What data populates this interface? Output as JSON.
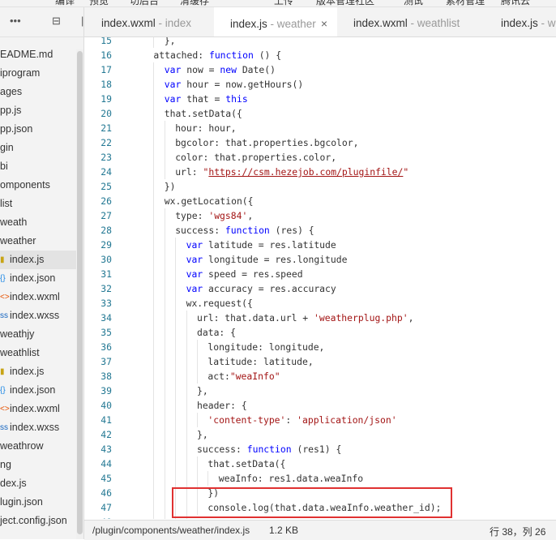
{
  "top_menu": [
    "编译",
    "预览",
    "切后台",
    "清缓存",
    "上传",
    "版本管理",
    "社区",
    "测试",
    "素材管理",
    "腾讯云"
  ],
  "tabs": [
    {
      "name": "index.wxml",
      "context": " - index",
      "active": false
    },
    {
      "name": "index.js",
      "context": " - weather",
      "active": true
    },
    {
      "name": "index.wxml",
      "context": " - weathlist",
      "active": false
    },
    {
      "name": "index.js",
      "context": " - weath",
      "active": false
    }
  ],
  "tab_close_glyph": "×",
  "sidebar": {
    "toolbar_icons": [
      "more-icon",
      "collapse-all-icon",
      "split-icon"
    ],
    "toolbar_glyphs": [
      "•••",
      "⊟",
      "|"
    ],
    "items": [
      {
        "label": "EADME.md",
        "icon": "",
        "selected": false
      },
      {
        "label": "iprogram",
        "icon": "",
        "selected": false
      },
      {
        "label": "ages",
        "icon": "",
        "selected": false
      },
      {
        "label": "pp.js",
        "icon": "",
        "selected": false
      },
      {
        "label": "pp.json",
        "icon": "",
        "selected": false
      },
      {
        "label": "gin",
        "icon": "",
        "selected": false
      },
      {
        "label": "bi",
        "icon": "",
        "selected": false
      },
      {
        "label": "omponents",
        "icon": "",
        "selected": false
      },
      {
        "label": "list",
        "icon": "",
        "selected": false
      },
      {
        "label": "weath",
        "icon": "",
        "selected": false
      },
      {
        "label": "weather",
        "icon": "",
        "selected": false
      },
      {
        "label": "index.js",
        "icon": "js",
        "selected": true
      },
      {
        "label": "index.json",
        "icon": "json",
        "selected": false
      },
      {
        "label": "index.wxml",
        "icon": "wxml",
        "selected": false
      },
      {
        "label": "index.wxss",
        "icon": "wxss",
        "selected": false
      },
      {
        "label": "weathjy",
        "icon": "",
        "selected": false
      },
      {
        "label": "weathlist",
        "icon": "",
        "selected": false
      },
      {
        "label": "index.js",
        "icon": "js",
        "selected": false
      },
      {
        "label": "index.json",
        "icon": "json",
        "selected": false
      },
      {
        "label": "index.wxml",
        "icon": "wxml",
        "selected": false
      },
      {
        "label": "index.wxss",
        "icon": "wxss",
        "selected": false
      },
      {
        "label": "weathrow",
        "icon": "",
        "selected": false
      },
      {
        "label": "ng",
        "icon": "",
        "selected": false
      },
      {
        "label": "dex.js",
        "icon": "",
        "selected": false
      },
      {
        "label": "lugin.json",
        "icon": "",
        "selected": false
      },
      {
        "label": "ject.config.json",
        "icon": "",
        "selected": false
      }
    ]
  },
  "icon_glyphs": {
    "js": "▮",
    "json": "{}",
    "wxml": "<>",
    "wxss": "ss"
  },
  "icon_colors": {
    "js": "#c8a415",
    "json": "#1e88e5",
    "wxml": "#e65100",
    "wxss": "#1565c0"
  },
  "code_lines": [
    {
      "n": "15",
      "indent": 2,
      "tokens": [
        {
          "t": "},"
        }
      ]
    },
    {
      "n": "16",
      "indent": 1,
      "tokens": [
        {
          "t": "attached: "
        },
        {
          "t": "function",
          "c": "kw"
        },
        {
          "t": " () {"
        }
      ]
    },
    {
      "n": "17",
      "indent": 2,
      "tokens": [
        {
          "t": "var",
          "c": "kw"
        },
        {
          "t": " now = "
        },
        {
          "t": "new",
          "c": "kw"
        },
        {
          "t": " Date()"
        }
      ]
    },
    {
      "n": "18",
      "indent": 2,
      "tokens": [
        {
          "t": "var",
          "c": "kw"
        },
        {
          "t": " hour = now.getHours()"
        }
      ]
    },
    {
      "n": "19",
      "indent": 2,
      "tokens": [
        {
          "t": "var",
          "c": "kw"
        },
        {
          "t": " that = "
        },
        {
          "t": "this",
          "c": "kw"
        }
      ]
    },
    {
      "n": "20",
      "indent": 2,
      "tokens": [
        {
          "t": "that.setData({"
        }
      ]
    },
    {
      "n": "21",
      "indent": 3,
      "tokens": [
        {
          "t": "hour: hour,"
        }
      ]
    },
    {
      "n": "22",
      "indent": 3,
      "tokens": [
        {
          "t": "bgcolor: that.properties.bgcolor,"
        }
      ]
    },
    {
      "n": "23",
      "indent": 3,
      "tokens": [
        {
          "t": "color: that.properties.color,"
        }
      ]
    },
    {
      "n": "24",
      "indent": 3,
      "tokens": [
        {
          "t": "url: "
        },
        {
          "t": "\"",
          "c": "str"
        },
        {
          "t": "https://csm.hezejob.com/pluginfile/",
          "c": "url"
        },
        {
          "t": "\"",
          "c": "str"
        }
      ]
    },
    {
      "n": "25",
      "indent": 2,
      "tokens": [
        {
          "t": "})"
        }
      ]
    },
    {
      "n": "26",
      "indent": 2,
      "tokens": [
        {
          "t": "wx.getLocation({"
        }
      ]
    },
    {
      "n": "27",
      "indent": 3,
      "tokens": [
        {
          "t": "type: "
        },
        {
          "t": "'wgs84'",
          "c": "str"
        },
        {
          "t": ","
        }
      ]
    },
    {
      "n": "28",
      "indent": 3,
      "tokens": [
        {
          "t": "success: "
        },
        {
          "t": "function",
          "c": "kw"
        },
        {
          "t": " (res) {"
        }
      ]
    },
    {
      "n": "29",
      "indent": 4,
      "tokens": [
        {
          "t": "var",
          "c": "kw"
        },
        {
          "t": " latitude = res.latitude"
        }
      ]
    },
    {
      "n": "30",
      "indent": 4,
      "tokens": [
        {
          "t": "var",
          "c": "kw"
        },
        {
          "t": " longitude = res.longitude"
        }
      ]
    },
    {
      "n": "31",
      "indent": 4,
      "tokens": [
        {
          "t": "var",
          "c": "kw"
        },
        {
          "t": " speed = res.speed"
        }
      ]
    },
    {
      "n": "32",
      "indent": 4,
      "tokens": [
        {
          "t": "var",
          "c": "kw"
        },
        {
          "t": " accuracy = res.accuracy"
        }
      ]
    },
    {
      "n": "33",
      "indent": 4,
      "tokens": [
        {
          "t": "wx.request({"
        }
      ]
    },
    {
      "n": "34",
      "indent": 5,
      "tokens": [
        {
          "t": "url: that.data.url + "
        },
        {
          "t": "'weatherplug.php'",
          "c": "str"
        },
        {
          "t": ","
        }
      ]
    },
    {
      "n": "35",
      "indent": 5,
      "tokens": [
        {
          "t": "data: {"
        }
      ]
    },
    {
      "n": "36",
      "indent": 6,
      "tokens": [
        {
          "t": "longitude: longitude,"
        }
      ]
    },
    {
      "n": "37",
      "indent": 6,
      "tokens": [
        {
          "t": "latitude: latitude,"
        }
      ]
    },
    {
      "n": "38",
      "indent": 6,
      "tokens": [
        {
          "t": "act:"
        },
        {
          "t": "\"weaInfo\"",
          "c": "str"
        }
      ]
    },
    {
      "n": "39",
      "indent": 5,
      "tokens": [
        {
          "t": "},"
        }
      ]
    },
    {
      "n": "40",
      "indent": 5,
      "tokens": [
        {
          "t": "header: {"
        }
      ]
    },
    {
      "n": "41",
      "indent": 6,
      "tokens": [
        {
          "t": "'content-type'",
          "c": "str"
        },
        {
          "t": ": "
        },
        {
          "t": "'application/json'",
          "c": "str"
        }
      ]
    },
    {
      "n": "42",
      "indent": 5,
      "tokens": [
        {
          "t": "},"
        }
      ]
    },
    {
      "n": "43",
      "indent": 5,
      "tokens": [
        {
          "t": "success: "
        },
        {
          "t": "function",
          "c": "kw"
        },
        {
          "t": " (res1) {"
        }
      ]
    },
    {
      "n": "44",
      "indent": 6,
      "tokens": [
        {
          "t": "that.setData({"
        }
      ]
    },
    {
      "n": "45",
      "indent": 7,
      "tokens": [
        {
          "t": "weaInfo: res1.data.weaInfo"
        }
      ]
    },
    {
      "n": "46",
      "indent": 6,
      "tokens": [
        {
          "t": "})"
        }
      ]
    },
    {
      "n": "47",
      "indent": 6,
      "tokens": [
        {
          "t": "console.log(that.data.weaInfo.weather_id);"
        }
      ]
    },
    {
      "n": "48",
      "indent": 5,
      "tokens": [
        {
          "t": ""
        }
      ]
    }
  ],
  "status": {
    "path": "/plugin/components/weather/index.js",
    "size": "1.2 KB",
    "cursor": "行 38，列 26"
  }
}
